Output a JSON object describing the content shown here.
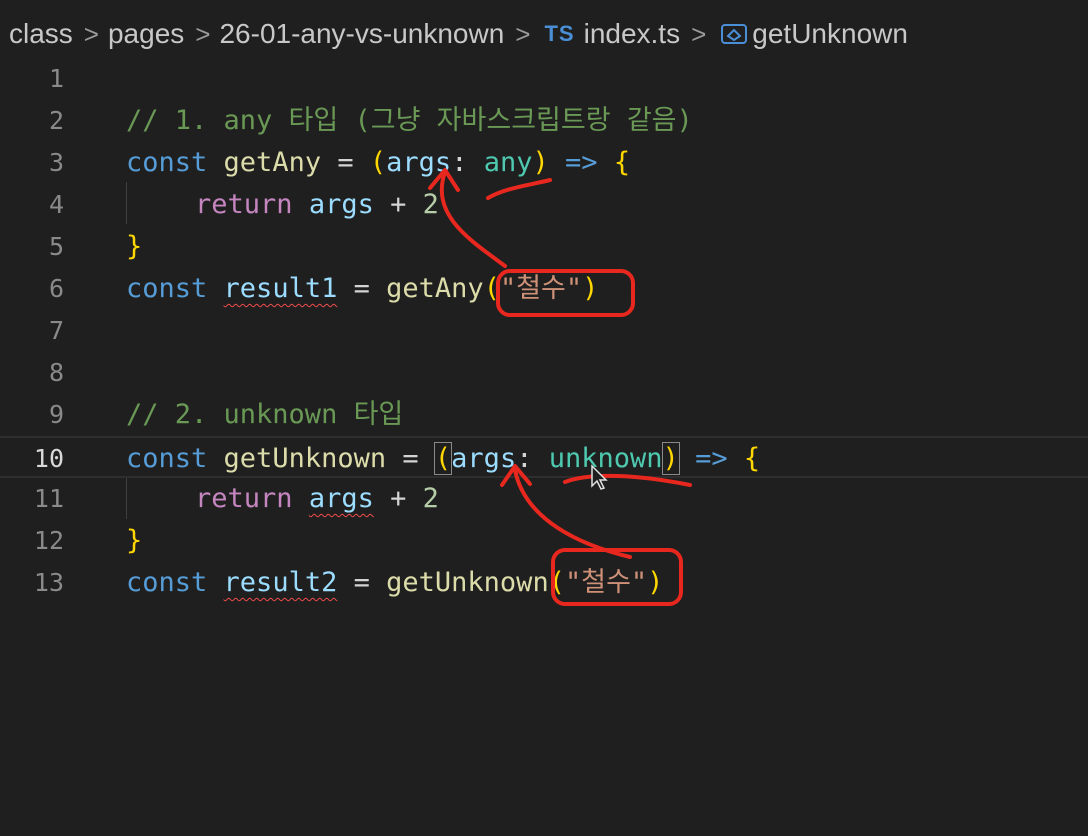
{
  "breadcrumb": {
    "items": [
      "class",
      "pages",
      "26-01-any-vs-unknown"
    ],
    "file_icon": "TS",
    "file": "index.ts",
    "symbol": "getUnknown",
    "symbol_icon": "method-icon"
  },
  "editor": {
    "current_line": 10,
    "lines": [
      {
        "n": "1"
      },
      {
        "n": "2"
      },
      {
        "n": "3"
      },
      {
        "n": "4"
      },
      {
        "n": "5"
      },
      {
        "n": "6"
      },
      {
        "n": "7"
      },
      {
        "n": "8"
      },
      {
        "n": "9"
      },
      {
        "n": "10"
      },
      {
        "n": "11"
      },
      {
        "n": "12"
      },
      {
        "n": "13"
      }
    ],
    "comment1": "// 1. any 타입 (그냥 자바스크립트랑 같음)",
    "comment2": "// 2. unknown 타입",
    "kw_const": "const",
    "kw_return": "return",
    "fn_getAny": "getAny",
    "fn_getUnknown": "getUnknown",
    "param": "args",
    "type_any": "any",
    "type_unknown": "unknown",
    "var_result1": "result1",
    "var_result2": "result2",
    "str_arg": "\"철수\"",
    "num_two": "2"
  },
  "colors": {
    "background": "#1f1f1f",
    "annotation": "#e8281e"
  }
}
